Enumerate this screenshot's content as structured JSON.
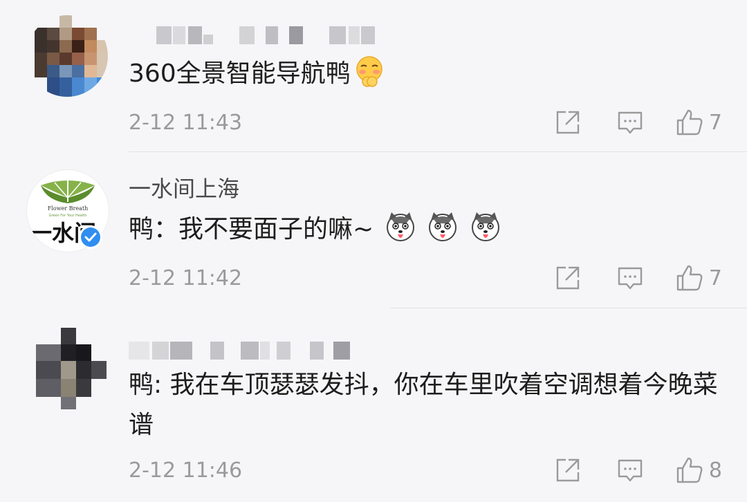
{
  "comments": [
    {
      "author": "",
      "text": "360全景智能导航鸭",
      "time": "2-12 11:43",
      "likes": "7",
      "emoji_icons": [
        "shy-face-emoji-icon"
      ]
    },
    {
      "author": "一水间上海",
      "text": "鸭：我不要面子的嘛~",
      "time": "2-12 11:42",
      "likes": "7",
      "verified": true,
      "avatar_text": {
        "brand": "Flower Breath",
        "tagline": "Green For Your Health",
        "chars": "一水间"
      },
      "emoji_icons": [
        "husky-emoji-icon",
        "husky-emoji-icon",
        "husky-emoji-icon"
      ]
    },
    {
      "author": "",
      "text": "鸭: 我在车顶瑟瑟发抖，你在车里吹着空调想着今晚菜谱",
      "time": "2-12 11:46",
      "likes": "8",
      "emoji_icons": []
    }
  ],
  "icons": {
    "share": "share-icon",
    "reply": "reply-icon",
    "like": "thumbs-up-icon",
    "verified": "verified-badge-icon"
  },
  "colors": {
    "background": "#f6f6f8",
    "text": "#1d1d1d",
    "muted": "#9a9a9a",
    "verified": "#2f8ef0"
  }
}
